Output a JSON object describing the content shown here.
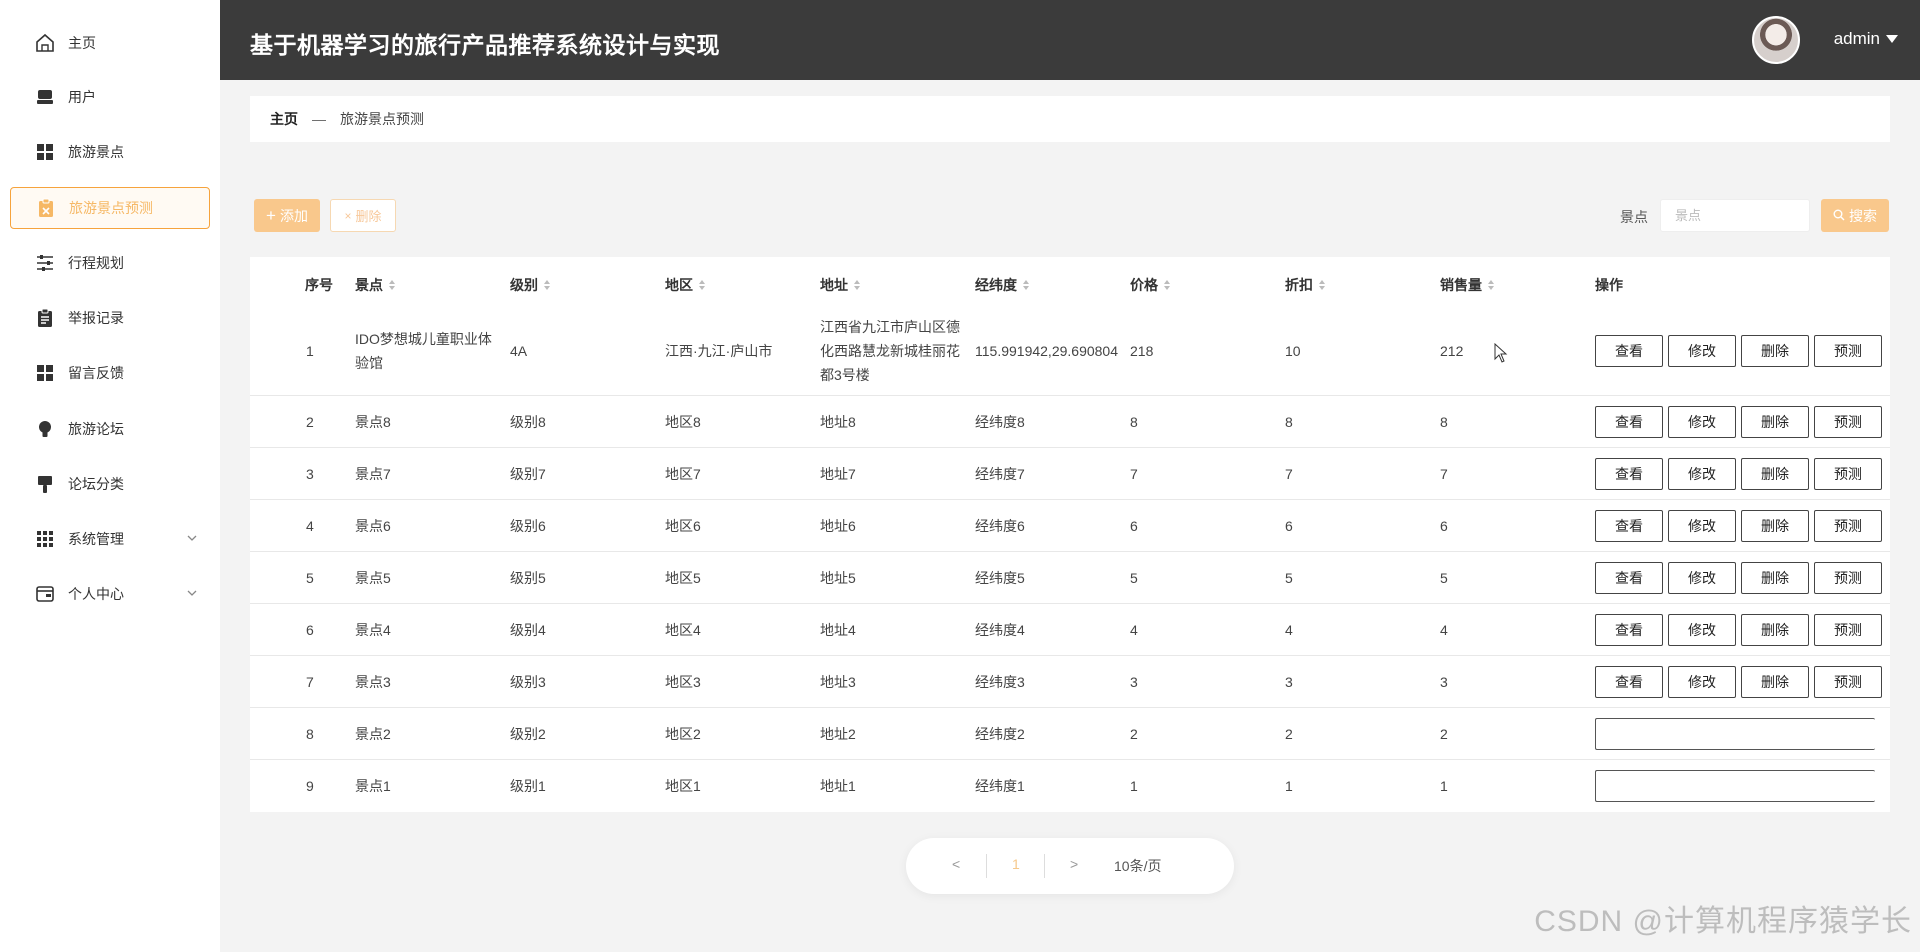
{
  "header": {
    "title": "基于机器学习的旅行产品推荐系统设计与实现",
    "user": "admin"
  },
  "sidebar": {
    "items": [
      {
        "label": "主页",
        "icon": "home-icon"
      },
      {
        "label": "用户",
        "icon": "user-icon"
      },
      {
        "label": "旅游景点",
        "icon": "grid-icon"
      },
      {
        "label": "旅游景点预测",
        "icon": "clipboard-icon",
        "active": true
      },
      {
        "label": "行程规划",
        "icon": "sliders-icon"
      },
      {
        "label": "举报记录",
        "icon": "clipboard-icon"
      },
      {
        "label": "留言反馈",
        "icon": "grid-icon"
      },
      {
        "label": "旅游论坛",
        "icon": "bulb-icon"
      },
      {
        "label": "论坛分类",
        "icon": "brush-icon"
      },
      {
        "label": "系统管理",
        "icon": "apps-icon",
        "expandable": true
      },
      {
        "label": "个人中心",
        "icon": "card-icon",
        "expandable": true
      }
    ]
  },
  "breadcrumb": {
    "home": "主页",
    "separator": "—",
    "current": "旅游景点预测"
  },
  "toolbar": {
    "add": "添加",
    "delete": "删除",
    "search_label": "景点",
    "search_placeholder": "景点",
    "search": "搜索"
  },
  "table": {
    "columns": [
      "序号",
      "景点",
      "级别",
      "地区",
      "地址",
      "经纬度",
      "价格",
      "折扣",
      "销售量",
      "操作"
    ],
    "actions": [
      "查看",
      "修改",
      "删除",
      "预测"
    ],
    "rows": [
      {
        "no": "1",
        "name": "IDO梦想城儿童职业体验馆",
        "level": "4A",
        "region": "江西·九江·庐山市",
        "address": "江西省九江市庐山区德化西路慧龙新城桂丽花都3号楼",
        "coords": "115.991942,29.690804",
        "price": "218",
        "discount": "10",
        "sales": "212"
      },
      {
        "no": "2",
        "name": "景点8",
        "level": "级别8",
        "region": "地区8",
        "address": "地址8",
        "coords": "经纬度8",
        "price": "8",
        "discount": "8",
        "sales": "8"
      },
      {
        "no": "3",
        "name": "景点7",
        "level": "级别7",
        "region": "地区7",
        "address": "地址7",
        "coords": "经纬度7",
        "price": "7",
        "discount": "7",
        "sales": "7"
      },
      {
        "no": "4",
        "name": "景点6",
        "level": "级别6",
        "region": "地区6",
        "address": "地址6",
        "coords": "经纬度6",
        "price": "6",
        "discount": "6",
        "sales": "6"
      },
      {
        "no": "5",
        "name": "景点5",
        "level": "级别5",
        "region": "地区5",
        "address": "地址5",
        "coords": "经纬度5",
        "price": "5",
        "discount": "5",
        "sales": "5"
      },
      {
        "no": "6",
        "name": "景点4",
        "level": "级别4",
        "region": "地区4",
        "address": "地址4",
        "coords": "经纬度4",
        "price": "4",
        "discount": "4",
        "sales": "4"
      },
      {
        "no": "7",
        "name": "景点3",
        "level": "级别3",
        "region": "地区3",
        "address": "地址3",
        "coords": "经纬度3",
        "price": "3",
        "discount": "3",
        "sales": "3"
      },
      {
        "no": "8",
        "name": "景点2",
        "level": "级别2",
        "region": "地区2",
        "address": "地址2",
        "coords": "经纬度2",
        "price": "2",
        "discount": "2",
        "sales": "2"
      },
      {
        "no": "9",
        "name": "景点1",
        "level": "级别1",
        "region": "地区1",
        "address": "地址1",
        "coords": "经纬度1",
        "price": "1",
        "discount": "1",
        "sales": "1"
      }
    ]
  },
  "pagination": {
    "prev": "<",
    "page": "1",
    "next": ">",
    "size": "10条/页"
  },
  "watermark": "CSDN @计算机程序猿学长"
}
